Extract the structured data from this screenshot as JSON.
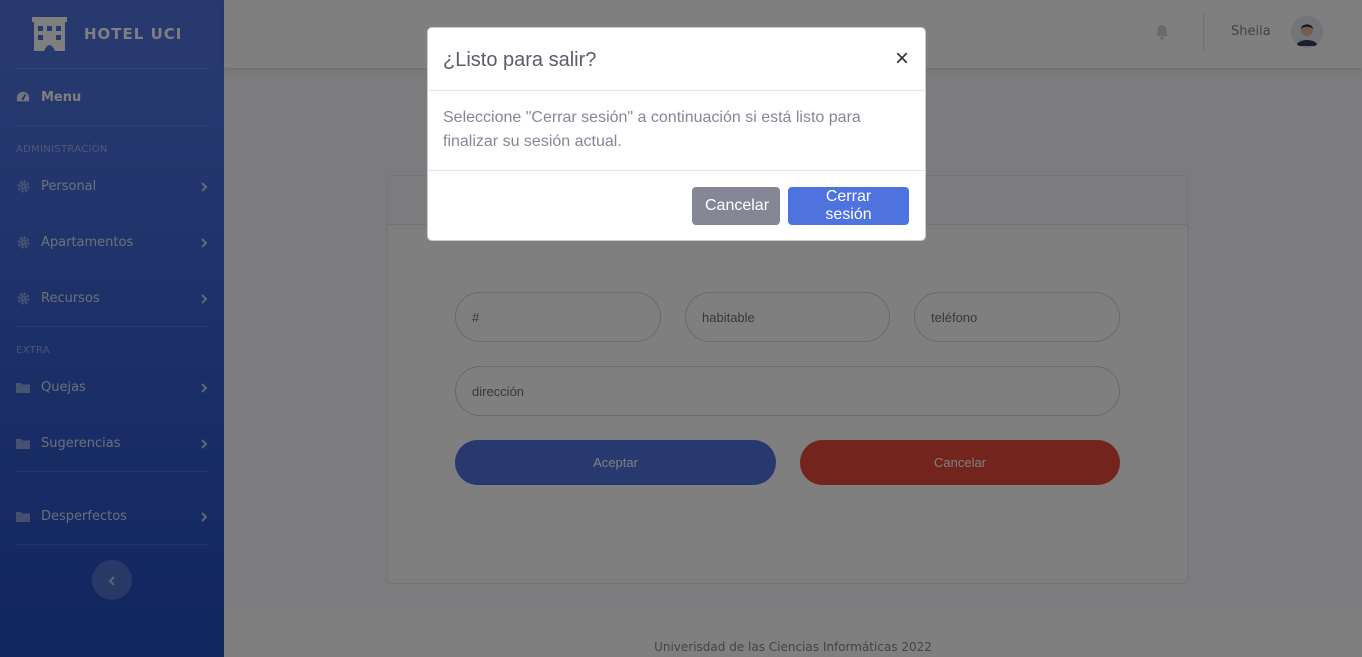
{
  "brand": {
    "name": "HOTEL UCI",
    "icon": "hotel-icon"
  },
  "sidebar": {
    "menu_label": "Menu",
    "heading_admin": "ADMINISTRACIÓN",
    "heading_extra": "EXTRA",
    "items": [
      {
        "label": "Personal",
        "icon": "cog-icon"
      },
      {
        "label": "Apartamentos",
        "icon": "cog-icon"
      },
      {
        "label": "Recursos",
        "icon": "cog-icon"
      },
      {
        "label": "Quejas",
        "icon": "folder-icon"
      },
      {
        "label": "Sugerencias",
        "icon": "folder-icon"
      },
      {
        "label": "Desperfectos",
        "icon": "folder-icon"
      }
    ]
  },
  "topbar": {
    "username": "Sheila"
  },
  "form": {
    "number_placeholder": "#",
    "habitable_placeholder": "habitable",
    "phone_placeholder": "teléfono",
    "address_placeholder": "dirección",
    "accept_label": "Aceptar",
    "cancel_label": "Cancelar"
  },
  "footer": {
    "text": "Univerisdad de las Ciencias Informáticas 2022"
  },
  "modal": {
    "title": "¿Listo para salir?",
    "close": "×",
    "body": "Seleccione \"Cerrar sesión\" a continuación si está listo para finalizar su sesión actual.",
    "cancel_label": "Cancelar",
    "logout_label": "Cerrar sesión"
  },
  "colors": {
    "primary": "#4e73df",
    "danger": "#e74a3b",
    "secondary": "#858796"
  }
}
